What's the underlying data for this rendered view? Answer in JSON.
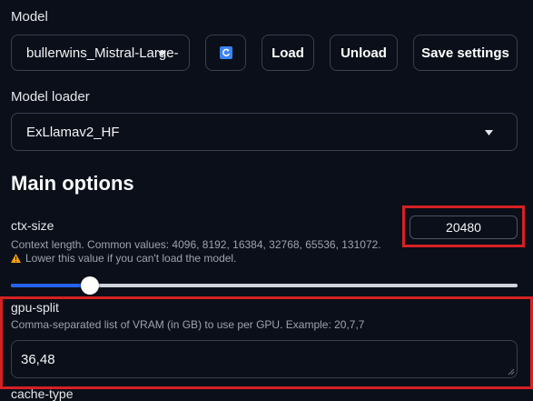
{
  "model": {
    "label": "Model",
    "value": "bullerwins_Mistral-Large-",
    "refresh_icon": "refresh-icon",
    "load_label": "Load",
    "unload_label": "Unload",
    "save_label": "Save settings"
  },
  "loader": {
    "label": "Model loader",
    "value": "ExLlamav2_HF",
    "dropdown_icon": "caret-down-icon"
  },
  "main_options": {
    "heading": "Main options"
  },
  "ctx_size": {
    "label": "ctx-size",
    "value": "20480",
    "description": "Context length. Common values: 4096, 8192, 16384, 32768, 65536, 131072.",
    "warning": "Lower this value if you can't load the model.",
    "warning_icon": "warning-icon",
    "slider_fraction": 0.156
  },
  "gpu_split": {
    "label": "gpu-split",
    "description": "Comma-separated list of VRAM (in GB) to use per GPU. Example: 20,7,7",
    "value": "36,48"
  },
  "cache_type": {
    "label": "cache-type"
  },
  "colors": {
    "background": "#0b0f19",
    "accent": "#2563eb",
    "highlight": "#d62124"
  }
}
